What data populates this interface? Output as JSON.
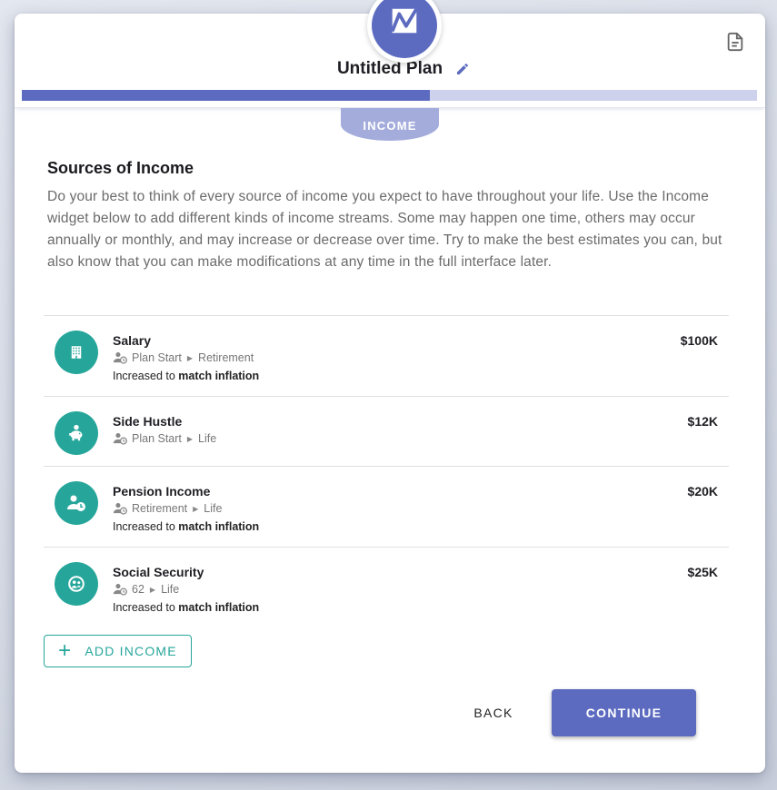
{
  "header": {
    "plan_title": "Untitled Plan",
    "progress_fraction": 0.555,
    "current_step": "INCOME"
  },
  "section": {
    "title": "Sources of Income",
    "description": "Do your best to think of every source of income you expect to have throughout your life. Use the Income widget below to add different kinds of income streams. Some may happen one time, others may occur annually or monthly, and may increase or decrease over time. Try to make the best estimates you can, but also know that you can make modifications at any time in the full interface later."
  },
  "income_items": [
    {
      "icon": "building-icon",
      "name": "Salary",
      "start": "Plan Start",
      "end": "Retirement",
      "growth_prefix": "Increased to",
      "growth_bold": "match inflation",
      "amount": "$100K"
    },
    {
      "icon": "piggy-bank-icon",
      "name": "Side Hustle",
      "start": "Plan Start",
      "end": "Life",
      "growth_prefix": null,
      "growth_bold": null,
      "amount": "$12K"
    },
    {
      "icon": "person-clock-icon",
      "name": "Pension Income",
      "start": "Retirement",
      "end": "Life",
      "growth_prefix": "Increased to",
      "growth_bold": "match inflation",
      "amount": "$20K"
    },
    {
      "icon": "social-security-icon",
      "name": "Social Security",
      "start": "62",
      "end": "Life",
      "growth_prefix": "Increased to",
      "growth_bold": "match inflation",
      "amount": "$25K"
    }
  ],
  "actions": {
    "add_income": "ADD INCOME",
    "back": "BACK",
    "continue": "CONTINUE"
  },
  "colors": {
    "primary": "#5c6bc0",
    "primary_light": "#cdd1eb",
    "step_tab": "#a4acdc",
    "accent_teal": "#26a69a"
  }
}
